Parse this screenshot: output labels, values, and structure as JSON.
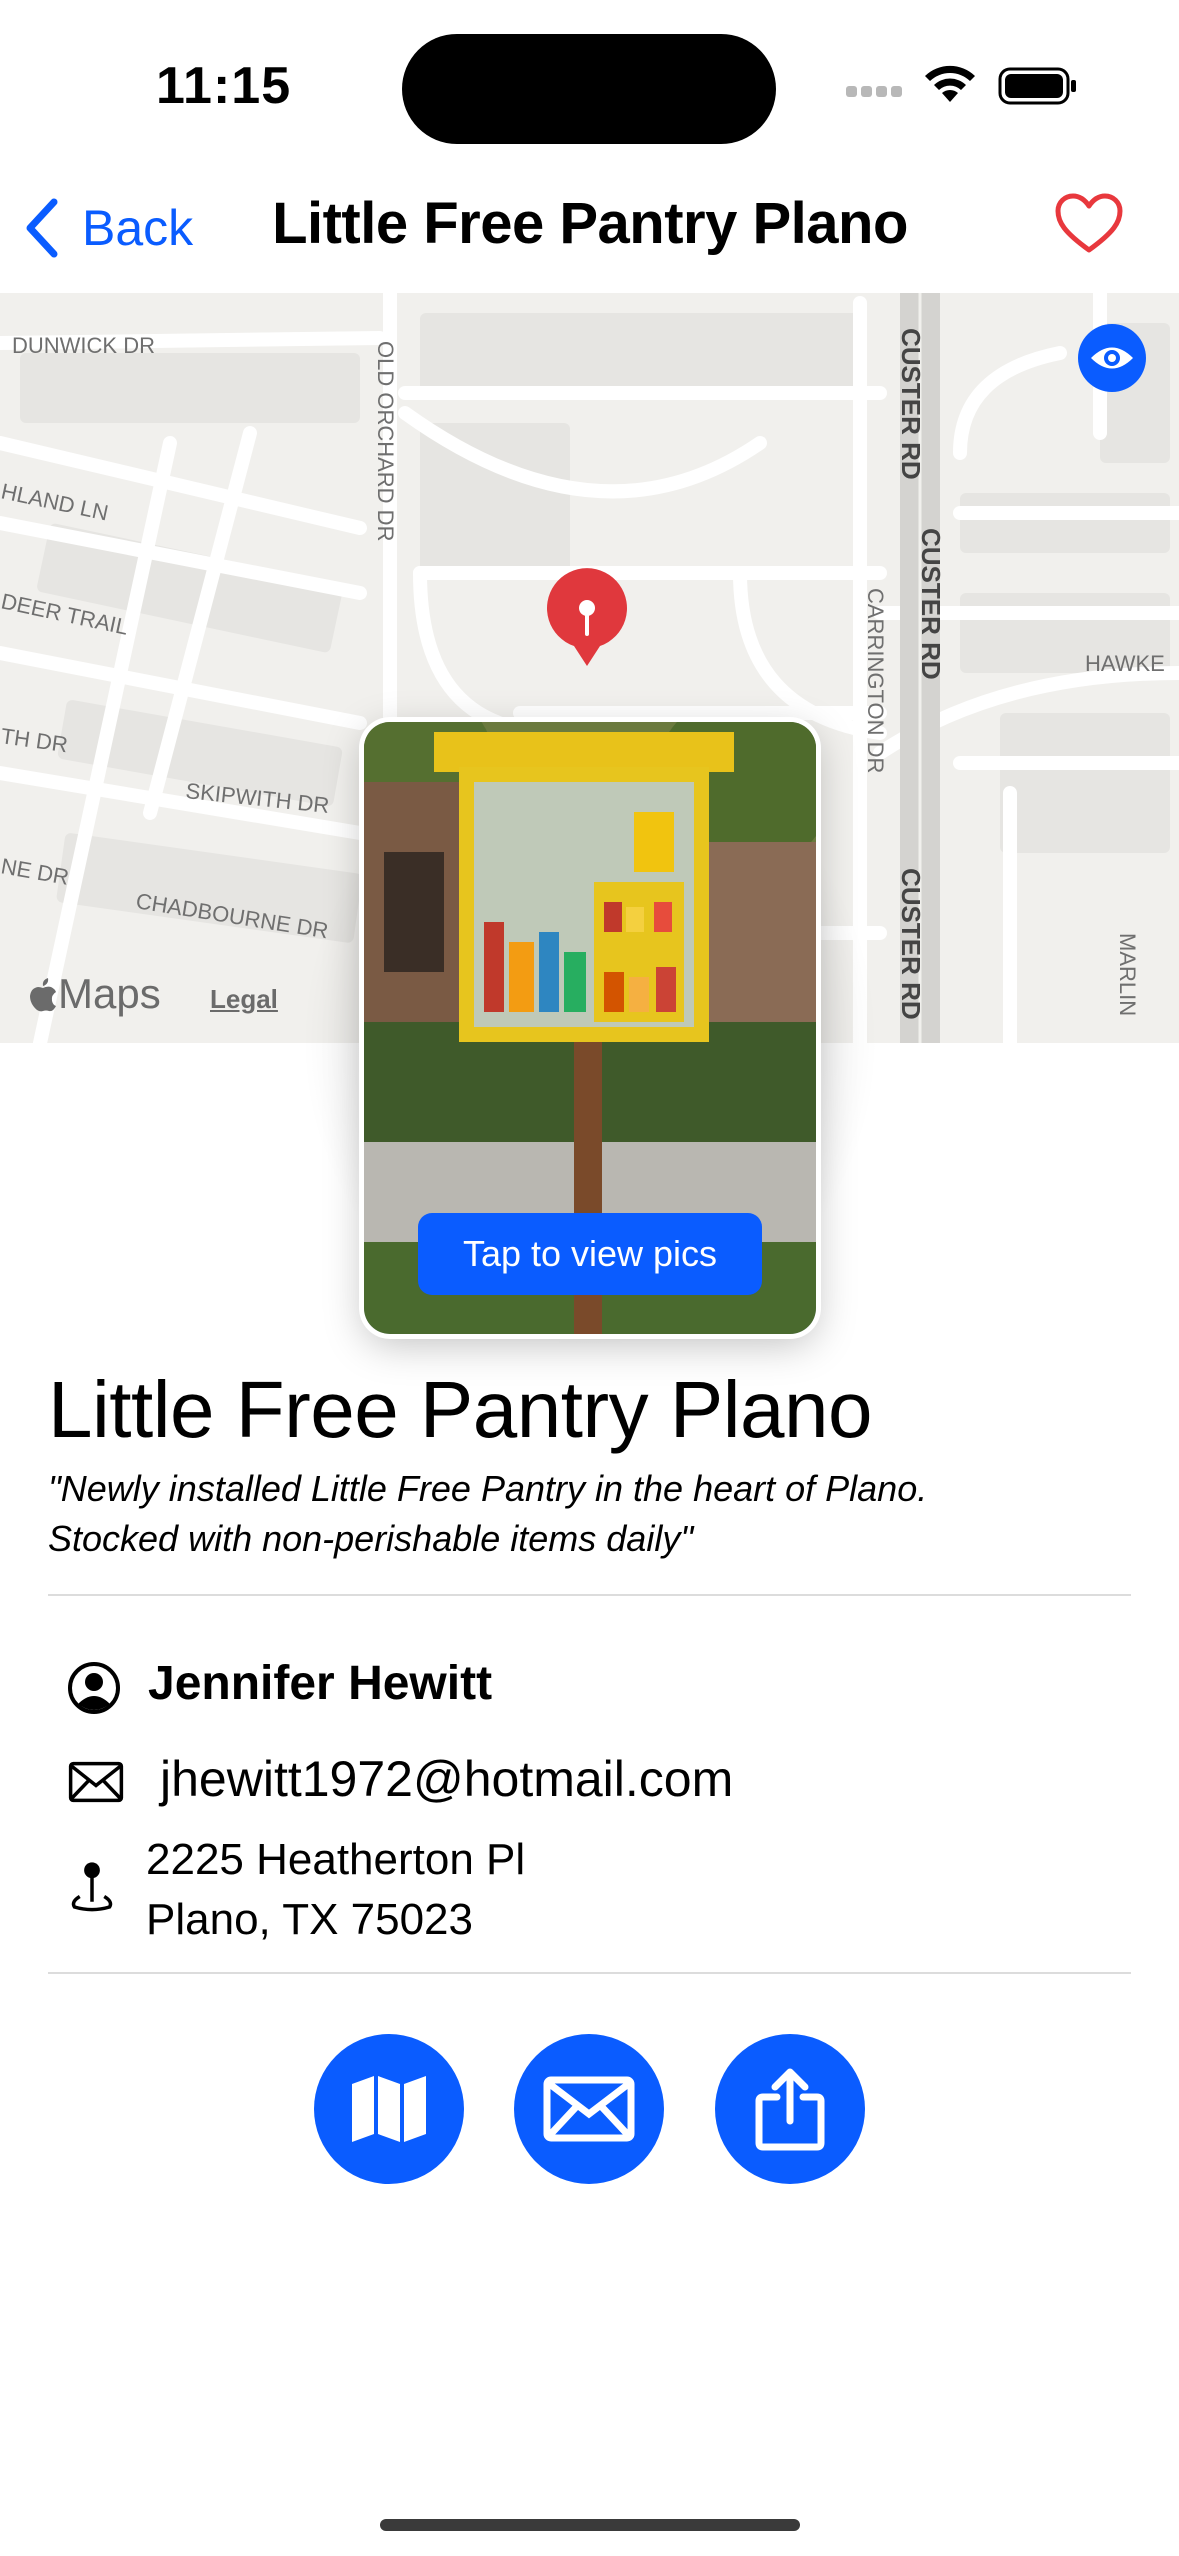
{
  "status_bar": {
    "time": "11:15"
  },
  "nav": {
    "back_label": "Back",
    "title": "Little Free Pantry Plano"
  },
  "map": {
    "attribution": "Maps",
    "legal": "Legal",
    "street_labels": [
      "DUNWICK DR",
      "HLAND LN",
      "DEER TRAIL",
      "TH DR",
      "SKIPWITH DR",
      "NE DR",
      "CHADBOURNE DR",
      "OLD ORCHARD DR",
      "CUSTER RD",
      "CUSTER RD",
      "CARRINGTON DR",
      "CUSTER RD",
      "HAWKE",
      "MARLIN"
    ]
  },
  "photo": {
    "button_label": "Tap to view pics"
  },
  "pantry": {
    "name": "Little Free Pantry Plano",
    "description_line1": "\"Newly installed Little Free Pantry in the heart of Plano.",
    "description_line2": "Stocked with non-perishable items daily\""
  },
  "contact": {
    "owner_name": "Jennifer Hewitt",
    "email": "jhewitt1972@hotmail.com",
    "address_line1": "2225 Heatherton Pl",
    "address_line2": "Plano, TX 75023"
  },
  "actions": [
    {
      "icon": "map-icon"
    },
    {
      "icon": "envelope-icon"
    },
    {
      "icon": "share-icon"
    }
  ],
  "colors": {
    "accent": "#0a5cff",
    "heart": "#e8383d",
    "pin": "#e0383d"
  }
}
